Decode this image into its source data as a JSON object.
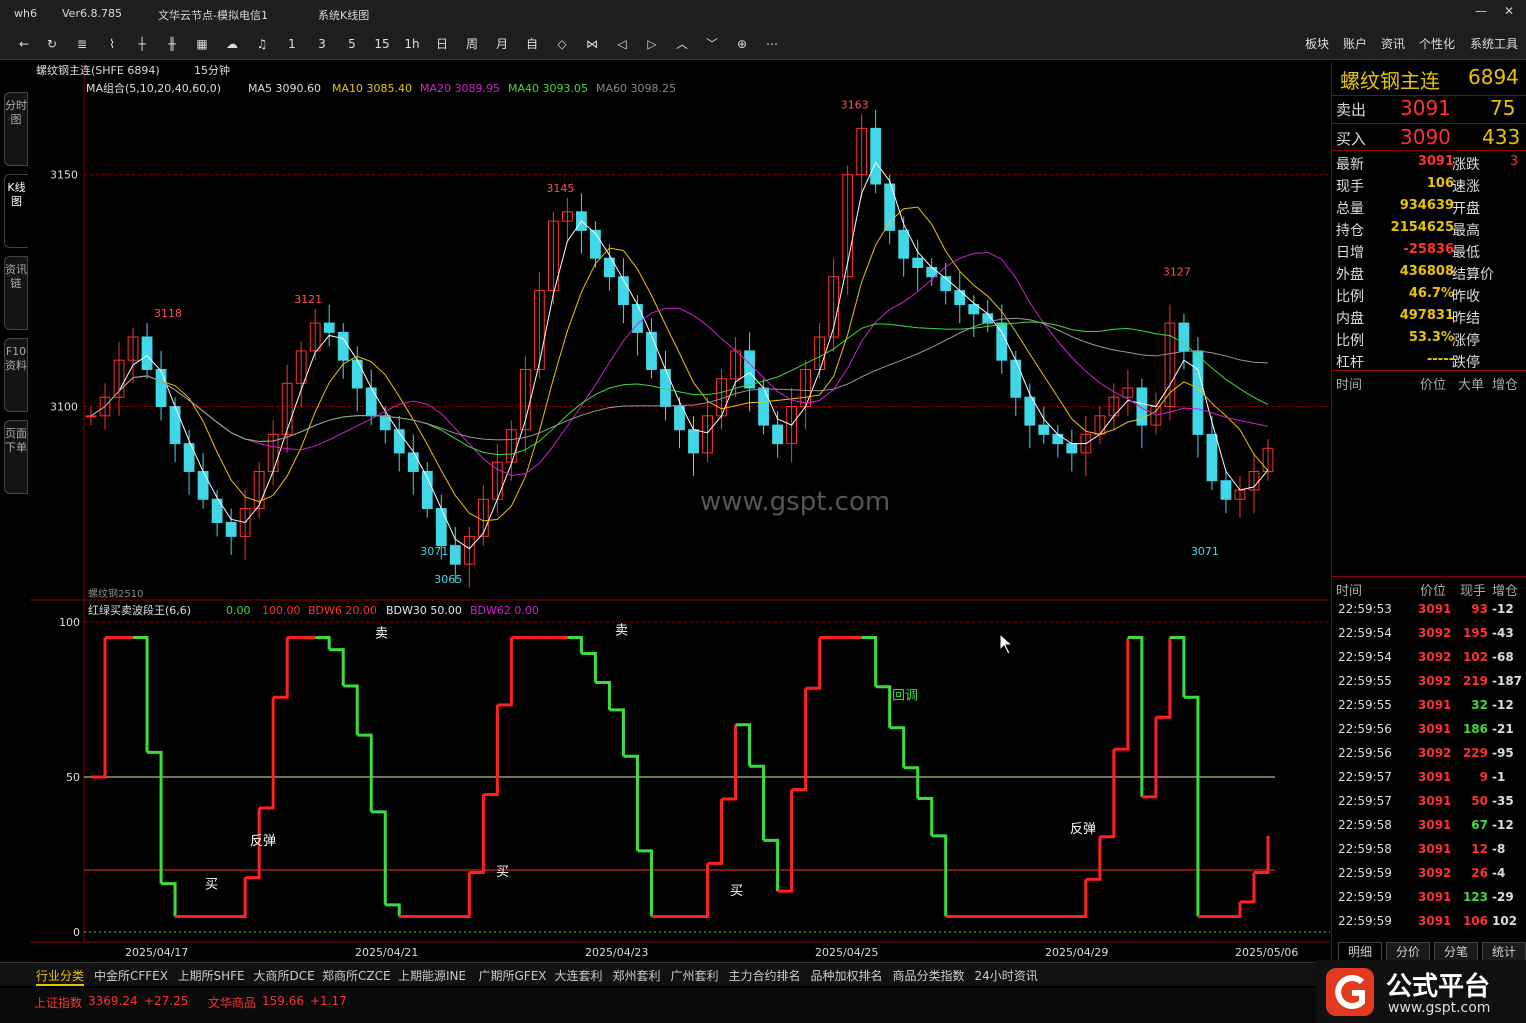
{
  "titlebar": {
    "app": "wh6",
    "version": "Ver6.8.785",
    "node": "文华云节点-模拟电信1",
    "view": "系统K线图"
  },
  "toolbar": {
    "icons": [
      "back-arrow-icon",
      "refresh-icon",
      "list-icon",
      "line-chart-icon",
      "bar-chart-icon",
      "candle-icon",
      "grid-icon",
      "cloud-icon",
      "bell-icon"
    ],
    "periods": [
      "1",
      "3",
      "5",
      "15",
      "1h",
      "日",
      "周",
      "月",
      "自"
    ],
    "right": [
      "板块",
      "账户",
      "资讯",
      "个性化",
      "系统工具"
    ]
  },
  "lefttabs": [
    "分时图",
    "K线图",
    "资讯链",
    "F10资料",
    "页面下单"
  ],
  "chart_header": {
    "symbol": "螺纹钢主连(SHFE 6894)",
    "period": "15分钟"
  },
  "ma": {
    "group": "MA组合(5,10,20,40,60,0)",
    "ma5": "MA5 3090.60",
    "ma10": "MA10 3085.40",
    "ma20": "MA20 3089.95",
    "ma40": "MA40 3093.05",
    "ma60": "MA60 3098.25"
  },
  "sub_header": {
    "name": "红绿买卖波段王(6,6)",
    "v1": "0.00",
    "v2": "100.00",
    "bdw6": "BDW6 20.00",
    "bdw30": "BDW30 50.00",
    "bdw62": "BDW62 0.00"
  },
  "contract_label": "螺纹钢2510",
  "watermark": "www.gspt.com",
  "chart_data": {
    "type": "candlestick",
    "price_axis": {
      "ticks": [
        3150,
        3100
      ],
      "range": [
        3060,
        3170
      ]
    },
    "sub_axis": {
      "ticks": [
        100,
        50,
        0
      ],
      "range": [
        0,
        100
      ]
    },
    "x_labels": [
      "2025/04/17",
      "2025/04/21",
      "2025/04/23",
      "2025/04/25",
      "2025/04/29",
      "2025/05/06"
    ],
    "extrema_labels": [
      {
        "label": "3118",
        "value": 3118
      },
      {
        "label": "3071",
        "value": 3071
      },
      {
        "label": "3121",
        "value": 3121
      },
      {
        "label": "3065",
        "value": 3065
      },
      {
        "label": "3145",
        "value": 3145
      },
      {
        "label": "3163",
        "value": 3163
      },
      {
        "label": "3127",
        "value": 3127
      },
      {
        "label": "3071",
        "value": 3071
      }
    ],
    "sub_signals": [
      "买",
      "反弹",
      "卖",
      "买",
      "卖",
      "买",
      "回调",
      "反弹"
    ],
    "close_path": [
      3098,
      3102,
      3110,
      3115,
      3108,
      3100,
      3092,
      3086,
      3080,
      3075,
      3072,
      3078,
      3086,
      3094,
      3105,
      3112,
      3118,
      3116,
      3110,
      3104,
      3098,
      3095,
      3090,
      3086,
      3078,
      3070,
      3066,
      3072,
      3080,
      3088,
      3095,
      3108,
      3125,
      3140,
      3142,
      3138,
      3132,
      3128,
      3122,
      3116,
      3108,
      3100,
      3095,
      3090,
      3098,
      3106,
      3112,
      3104,
      3096,
      3092,
      3100,
      3108,
      3115,
      3128,
      3150,
      3160,
      3148,
      3138,
      3132,
      3130,
      3128,
      3125,
      3122,
      3120,
      3118,
      3110,
      3102,
      3096,
      3094,
      3092,
      3090,
      3094,
      3098,
      3102,
      3104,
      3096,
      3100,
      3118,
      3112,
      3094,
      3084,
      3080,
      3082,
      3086,
      3091
    ]
  },
  "right_panel": {
    "name": "螺纹钢主连",
    "code": "6894",
    "sell": {
      "label": "卖出",
      "price": "3091",
      "vol": "75"
    },
    "buy": {
      "label": "买入",
      "price": "3090",
      "vol": "433"
    },
    "stats": [
      {
        "k": "最新",
        "v": "3091",
        "k2": "涨跌",
        "v2": "3"
      },
      {
        "k": "现手",
        "v": "106",
        "k2": "速涨",
        "v2": ""
      },
      {
        "k": "总量",
        "v": "934639",
        "k2": "开盘",
        "v2": ""
      },
      {
        "k": "持仓",
        "v": "2154625",
        "k2": "最高",
        "v2": ""
      },
      {
        "k": "日增",
        "v": "-25836",
        "k2": "最低",
        "v2": ""
      },
      {
        "k": "外盘",
        "v": "436808",
        "k2": "结算价",
        "v2": ""
      },
      {
        "k": "比例",
        "v": "46.7%",
        "k2": "昨收",
        "v2": ""
      },
      {
        "k": "内盘",
        "v": "497831",
        "k2": "昨结",
        "v2": ""
      },
      {
        "k": "比例",
        "v": "53.3%",
        "k2": "涨停",
        "v2": ""
      },
      {
        "k": "杠杆",
        "v": "-----",
        "k2": "跌停",
        "v2": ""
      }
    ],
    "mid_header": [
      "时间",
      "价位",
      "大单",
      "增仓"
    ],
    "tick_header": [
      "时间",
      "价位",
      "现手",
      "增仓"
    ],
    "ticks": [
      [
        "22:59:53",
        "3091",
        "93",
        "-12"
      ],
      [
        "22:59:54",
        "3092",
        "195",
        "-43"
      ],
      [
        "22:59:54",
        "3092",
        "102",
        "-68"
      ],
      [
        "22:59:55",
        "3092",
        "219",
        "-187"
      ],
      [
        "22:59:55",
        "3091",
        "32",
        "-12"
      ],
      [
        "22:59:56",
        "3091",
        "186",
        "-21"
      ],
      [
        "22:59:56",
        "3092",
        "229",
        "-95"
      ],
      [
        "22:59:57",
        "3091",
        "9",
        "-1"
      ],
      [
        "22:59:57",
        "3091",
        "50",
        "-35"
      ],
      [
        "22:59:58",
        "3091",
        "67",
        "-12"
      ],
      [
        "22:59:58",
        "3091",
        "12",
        "-8"
      ],
      [
        "22:59:59",
        "3092",
        "26",
        "-4"
      ],
      [
        "22:59:59",
        "3091",
        "123",
        "-29"
      ],
      [
        "22:59:59",
        "3091",
        "106",
        "102"
      ]
    ],
    "foot_tabs": [
      "明细",
      "分价",
      "分笔",
      "统计"
    ]
  },
  "bottom_tabs": [
    "行业分类",
    "中金所CFFEX",
    "上期所SHFE",
    "大商所DCE",
    "郑商所CZCE",
    "上期能源INE",
    "广期所GFEX",
    "大连套利",
    "郑州套利",
    "广州套利",
    "主力合约排名",
    "品种加权排名",
    "商品分类指数",
    "24小时资讯"
  ],
  "status": {
    "idx1_name": "上证指数",
    "idx1_val": "3369.24",
    "idx1_chg": "+27.25",
    "idx2_name": "文华商品",
    "idx2_val": "159.66",
    "idx2_chg": "+1.17"
  },
  "logo": {
    "cn": "公式平台",
    "url": "www.gspt.com"
  }
}
